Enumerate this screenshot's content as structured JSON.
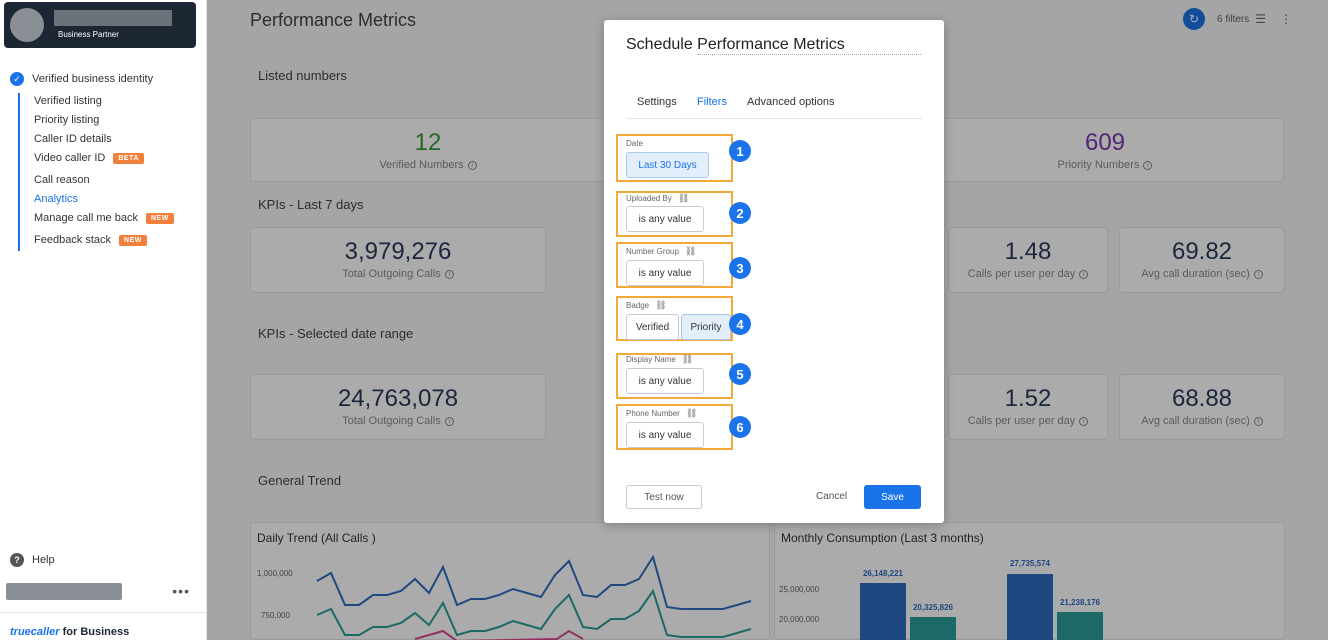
{
  "sidebar": {
    "role": "Business Partner",
    "nav_head": "Verified business identity",
    "items": [
      {
        "label": "Verified listing"
      },
      {
        "label": "Priority listing"
      },
      {
        "label": "Caller ID details"
      },
      {
        "label": "Video caller ID",
        "tag": "BETA"
      },
      {
        "label": "Call reason"
      },
      {
        "label": "Analytics",
        "active": true
      },
      {
        "label": "Manage call me back",
        "tag": "NEW"
      },
      {
        "label": "Feedback stack",
        "tag": "NEW"
      }
    ],
    "help": "Help",
    "brand": {
      "logo": "truecaller",
      "suffix": "for Business"
    }
  },
  "header": {
    "title": "Performance Metrics",
    "filters_count": "6 filters"
  },
  "sections": {
    "listed_numbers": "Listed numbers",
    "kpis_7": "KPIs - Last 7 days",
    "kpis_range": "KPIs - Selected date range",
    "general_trend": "General Trend"
  },
  "listed": [
    {
      "value": "12",
      "label": "Verified Numbers"
    },
    {
      "value": "609",
      "label": "Priority Numbers"
    }
  ],
  "kpi7": [
    {
      "value": "3,979,276",
      "label": "Total Outgoing Calls"
    },
    {
      "value": "1.48",
      "label": "Calls per user per day"
    },
    {
      "value": "69.82",
      "label": "Avg call duration (sec)"
    }
  ],
  "kpirange": [
    {
      "value": "24,763,078",
      "label": "Total Outgoing Calls"
    },
    {
      "value": "1.52",
      "label": "Calls per user per day"
    },
    {
      "value": "68.88",
      "label": "Avg call duration (sec)"
    }
  ],
  "charts": {
    "daily_title": "Daily Trend (All Calls )",
    "daily_ticks": [
      "1,000,000",
      "750,000"
    ],
    "monthly_title": "Monthly Consumption (Last 3 months)",
    "monthly_ticks": [
      "25,000,000",
      "20,000,000"
    ],
    "monthly_labels": [
      "26,148,221",
      "20,325,826",
      "27,735,574",
      "21,238,176"
    ],
    "colors": {
      "blue": "#2f6cc0",
      "teal": "#2a9d9a",
      "pink": "#d84a8f"
    }
  },
  "modal": {
    "title_prefix": "Schedule",
    "title_name": "Performance Metrics",
    "tabs": [
      "Settings",
      "Filters",
      "Advanced options"
    ],
    "active_tab": "Filters",
    "filters": [
      {
        "label": "Date",
        "value": "Last 30 Days",
        "num": "1"
      },
      {
        "label": "Uploaded By",
        "value": "is any value",
        "num": "2"
      },
      {
        "label": "Number Group",
        "value": "is any value",
        "num": "3"
      },
      {
        "label": "Badge",
        "options": [
          "Verified",
          "Priority"
        ],
        "num": "4"
      },
      {
        "label": "Display Name",
        "value": "is any value",
        "num": "5"
      },
      {
        "label": "Phone Number",
        "value": "is any value",
        "num": "6"
      }
    ],
    "test_now": "Test now",
    "cancel": "Cancel",
    "save": "Save"
  },
  "accent_color": "#1a73e8",
  "highlight_color": "#f2a93b"
}
